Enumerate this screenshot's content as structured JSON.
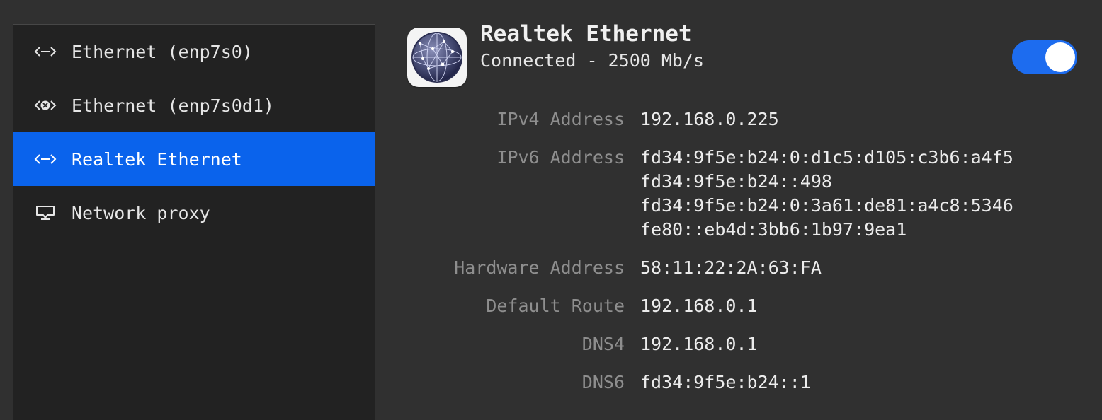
{
  "sidebar": {
    "items": [
      {
        "label": "Ethernet (enp7s0)",
        "icon": "ethernet-icon",
        "selected": false
      },
      {
        "label": "Ethernet (enp7s0d1)",
        "icon": "ethernet-disconnected-icon",
        "selected": false
      },
      {
        "label": "Realtek Ethernet",
        "icon": "ethernet-icon",
        "selected": true
      },
      {
        "label": "Network proxy",
        "icon": "network-proxy-icon",
        "selected": false
      }
    ]
  },
  "header": {
    "icon": "network-globe-icon",
    "title": "Realtek Ethernet",
    "subtitle": "Connected - 2500 Mb/s",
    "toggle_on": true
  },
  "details": {
    "ipv4": {
      "label": "IPv4 Address",
      "values": [
        "192.168.0.225"
      ]
    },
    "ipv6": {
      "label": "IPv6 Address",
      "values": [
        "fd34:9f5e:b24:0:d1c5:d105:c3b6:a4f5",
        "fd34:9f5e:b24::498",
        "fd34:9f5e:b24:0:3a61:de81:a4c8:5346",
        "fe80::eb4d:3bb6:1b97:9ea1"
      ]
    },
    "hardware": {
      "label": "Hardware Address",
      "values": [
        "58:11:22:2A:63:FA"
      ]
    },
    "route": {
      "label": "Default Route",
      "values": [
        "192.168.0.1"
      ]
    },
    "dns4": {
      "label": "DNS4",
      "values": [
        "192.168.0.1"
      ]
    },
    "dns6": {
      "label": "DNS6",
      "values": [
        "fd34:9f5e:b24::1"
      ]
    }
  },
  "colors": {
    "background": "#303030",
    "sidebar": "#222222",
    "accent": "#0a63ec",
    "label": "#8e8e8e"
  }
}
